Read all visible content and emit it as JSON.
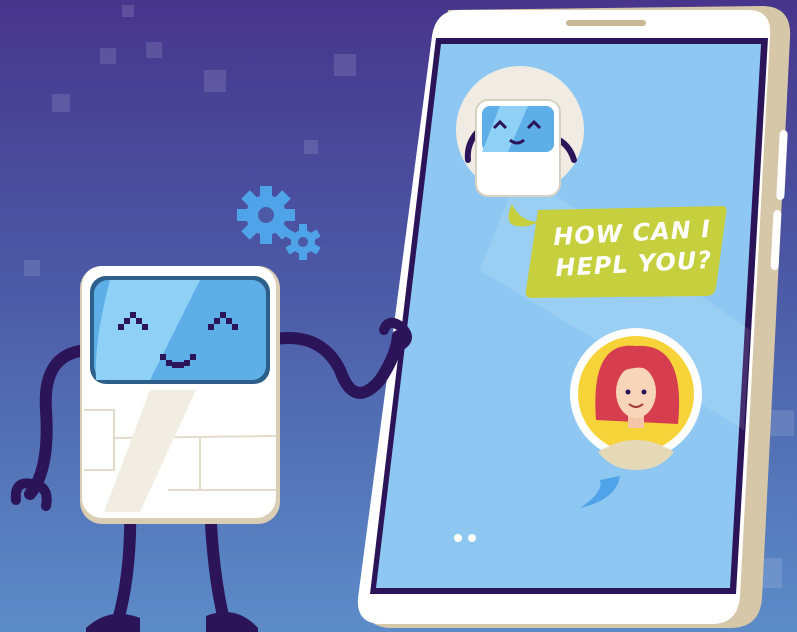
{
  "chat": {
    "bot_message": "HOW CAN I HEPL YOU?"
  },
  "colors": {
    "background_top": "#47358c",
    "background_bottom": "#5c8cc8",
    "phone_body": "#ffffff",
    "phone_edge": "#d6c7a8",
    "screen": "#8ec8f2",
    "bubble": "#c6cf3e",
    "robot_limbs": "#2c1459",
    "gears": "#4fa3e8",
    "avatar_bg": "#f7d33a"
  },
  "icons": [
    "robot",
    "smartphone",
    "gear",
    "robot-avatar",
    "woman-avatar",
    "chat-bubble"
  ]
}
